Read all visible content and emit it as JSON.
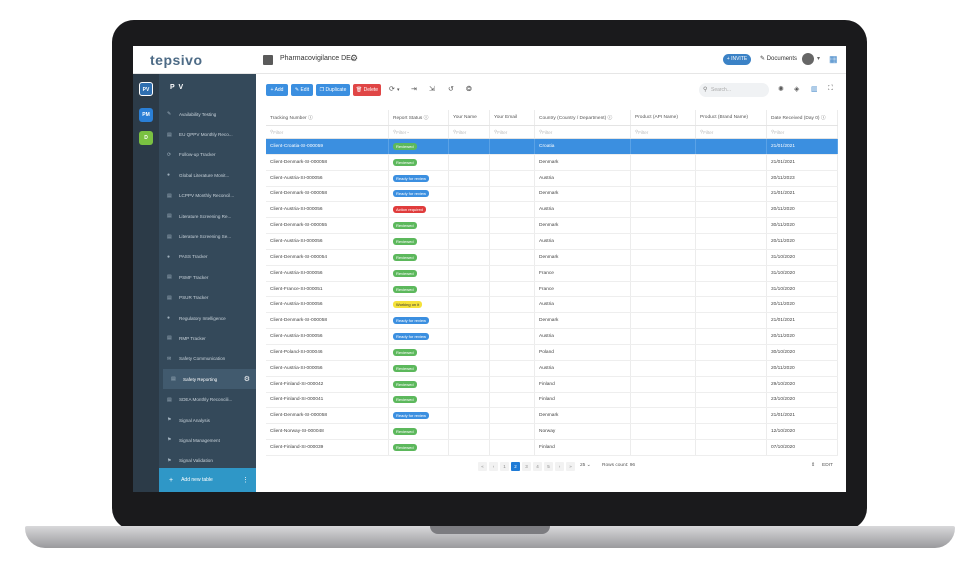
{
  "app": {
    "logo": "tepsivo",
    "workspace_title": "Pharmacovigilance DE..",
    "invite_label": "+ INVITE",
    "documents_label": "Documents"
  },
  "rail": [
    {
      "label": "PV",
      "color": "#2f6fb0"
    },
    {
      "label": "PM",
      "color": "#2a7fd6"
    },
    {
      "label": "D",
      "color": "#7ac142"
    }
  ],
  "sidebar": {
    "header": "P V",
    "items": [
      {
        "label": "Availability Testing",
        "icon": "✎"
      },
      {
        "label": "EU QPPV Monthly Reco...",
        "icon": "▤"
      },
      {
        "label": "Follow-up Tracker",
        "icon": "⟳"
      },
      {
        "label": "Global Literature Monit...",
        "icon": "●"
      },
      {
        "label": "LCPPV Monthly Reconcil...",
        "icon": "▤"
      },
      {
        "label": "Literature Screening Re...",
        "icon": "▤"
      },
      {
        "label": "Literature Screening Se...",
        "icon": "▤"
      },
      {
        "label": "PASS Tracker",
        "icon": "●"
      },
      {
        "label": "PSMF Tracker",
        "icon": "▤"
      },
      {
        "label": "PSUR Tracker",
        "icon": "▤"
      },
      {
        "label": "Regulatory Intelligence",
        "icon": "●"
      },
      {
        "label": "RMP Tracker",
        "icon": "▤"
      },
      {
        "label": "Safety Communication",
        "icon": "✉"
      },
      {
        "label": "Safety Reporting",
        "icon": "▤",
        "active": true
      },
      {
        "label": "SDEA Monthly Reconcili...",
        "icon": "▤"
      },
      {
        "label": "Signal Analysis",
        "icon": "⚑"
      },
      {
        "label": "Signal Management",
        "icon": "⚑"
      },
      {
        "label": "Signal Validation",
        "icon": "⚑"
      }
    ],
    "add_new_table": "Add new table"
  },
  "toolbar": {
    "add": "+ Add",
    "edit": "✎ Edit",
    "duplicate": "❐ Duplicate",
    "delete": "🗑 Delete",
    "search_placeholder": "Search...",
    "colors": {
      "add": "#3b8fe0",
      "edit": "#3b8fe0",
      "duplicate": "#3b8fe0",
      "delete": "#e04646"
    }
  },
  "grid": {
    "columns": [
      "Tracking Number ⓘ",
      "Report Status ⓘ",
      "Your Name",
      "Your Email",
      "Country (Country / Department) ⓘ",
      "Product (API Name)",
      "Product (Brand Name)",
      "Date Received (Day 0) ⓘ"
    ],
    "filter_placeholder": "Filter",
    "status_colors": {
      "Reviewed": "#5cb85c",
      "Ready for review": "#3b8fe0",
      "Action required": "#e03c3c",
      "Working on it": "#f5e23a"
    },
    "rows": [
      {
        "id": "Client-Croatia-SI-000059",
        "status": "Reviewed",
        "country": "Croatia",
        "date": "21/01/2021",
        "selected": true
      },
      {
        "id": "Client-Denmark-SI-000058",
        "status": "Reviewed",
        "country": "Denmark",
        "date": "21/01/2021"
      },
      {
        "id": "Client-Austria-SI-000056",
        "status": "Ready for review",
        "country": "Austria",
        "date": "20/11/2023"
      },
      {
        "id": "Client-Denmark-SI-000058",
        "status": "Ready for review",
        "country": "Denmark",
        "date": "21/01/2021"
      },
      {
        "id": "Client-Austria-SI-000056",
        "status": "Action required",
        "country": "Austria",
        "date": "20/11/2020"
      },
      {
        "id": "Client-Denmark-SI-000055",
        "status": "Reviewed",
        "country": "Denmark",
        "date": "30/11/2020"
      },
      {
        "id": "Client-Austria-SI-000056",
        "status": "Reviewed",
        "country": "Austria",
        "date": "20/11/2020"
      },
      {
        "id": "Client-Denmark-SI-000054",
        "status": "Reviewed",
        "country": "Denmark",
        "date": "31/10/2020"
      },
      {
        "id": "Client-Austria-SI-000056",
        "status": "Reviewed",
        "country": "France",
        "date": "31/10/2020"
      },
      {
        "id": "Client-France-SI-000051",
        "status": "Reviewed",
        "country": "France",
        "date": "31/10/2020"
      },
      {
        "id": "Client-Austria-SI-000056",
        "status": "Working on it",
        "country": "Austria",
        "date": "20/11/2020"
      },
      {
        "id": "Client-Denmark-SI-000058",
        "status": "Ready for review",
        "country": "Denmark",
        "date": "21/01/2021"
      },
      {
        "id": "Client-Austria-SI-000056",
        "status": "Ready for review",
        "country": "Austria",
        "date": "20/11/2020"
      },
      {
        "id": "Client-Poland-SI-000046",
        "status": "Reviewed",
        "country": "Poland",
        "date": "30/10/2020"
      },
      {
        "id": "Client-Austria-SI-000056",
        "status": "Reviewed",
        "country": "Austria",
        "date": "20/11/2020"
      },
      {
        "id": "Client-Finland-SI-000042",
        "status": "Reviewed",
        "country": "Finland",
        "date": "29/10/2020"
      },
      {
        "id": "Client-Finland-SI-000041",
        "status": "Reviewed",
        "country": "Finland",
        "date": "23/10/2020"
      },
      {
        "id": "Client-Denmark-SI-000058",
        "status": "Ready for review",
        "country": "Denmark",
        "date": "21/01/2021"
      },
      {
        "id": "Client-Norway-SI-000048",
        "status": "Reviewed",
        "country": "Norway",
        "date": "12/10/2020"
      },
      {
        "id": "Client-Finland-SI-000039",
        "status": "Reviewed",
        "country": "Finland",
        "date": "07/10/2020"
      }
    ]
  },
  "pager": {
    "pages": [
      "1",
      "2",
      "3",
      "4",
      "5"
    ],
    "current": "2",
    "page_size": "25",
    "rows_count": "Rows count: 96",
    "edit_label": "EDIT"
  }
}
